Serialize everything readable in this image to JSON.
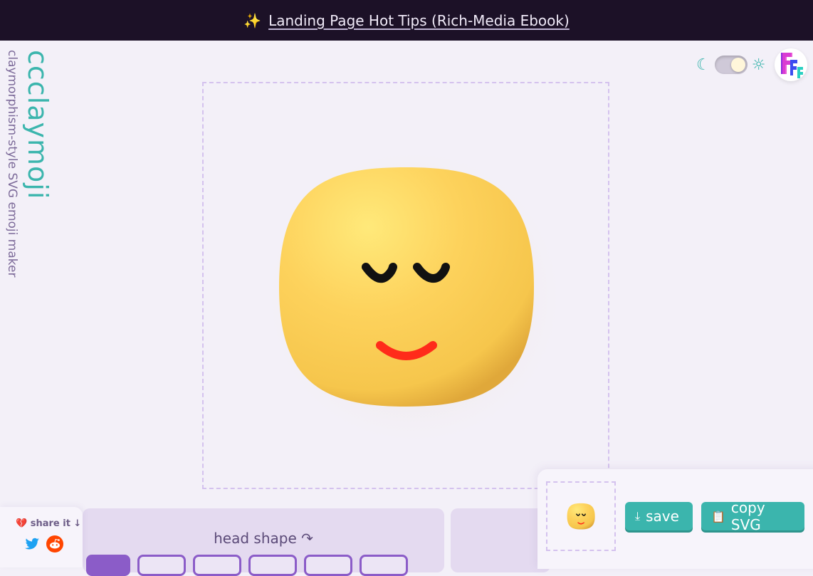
{
  "topbar": {
    "sparkle_icon": "sparkles-icon",
    "link_text": "Landing Page Hot Tips (Rich-Media Ebook)"
  },
  "brand": {
    "name": "ccclaymoji",
    "tagline": "claymorphism-style SVG emoji maker",
    "accent": "#3bb5ad"
  },
  "theme": {
    "moon": "☾",
    "sun": "☼",
    "mode": "light"
  },
  "emoji": {
    "expression": "calm smile",
    "face_color": "#fcd15a",
    "mouth_color": "#ff2b1a",
    "eye_color": "#111111"
  },
  "controls": {
    "head_shape_title": "head shape ↷",
    "options_visible": 6,
    "selected_index": 0
  },
  "share": {
    "label": "share it ↓",
    "heart_icon": "heart-icon",
    "networks": [
      "twitter",
      "reddit"
    ]
  },
  "actions": {
    "save_label": "save",
    "copy_label": "copy SVG"
  }
}
